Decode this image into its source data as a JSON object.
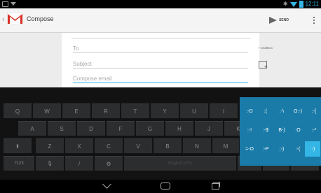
{
  "status_bar": {
    "time": "12:11",
    "bluetooth_glyph": "✱"
  },
  "action_bar": {
    "up_glyph": "‹",
    "title": "Compose",
    "send_label": "SEND"
  },
  "compose": {
    "to_placeholder": "To",
    "subject_placeholder": "Subject",
    "body_placeholder": "Compose email",
    "cc_bcc_label": "+ CC/BCC",
    "attach_plus": "+"
  },
  "keyboard": {
    "row1": [
      "Q",
      "W",
      "E",
      "R",
      "T",
      "Y",
      "U",
      "I"
    ],
    "row2": [
      "A",
      "S",
      "D",
      "F",
      "G",
      "H",
      "J",
      "K"
    ],
    "row3": [
      "Z",
      "X",
      "C",
      "V",
      "B",
      "N",
      "M"
    ],
    "shift_glyph": "⬆",
    "row4": {
      "symbols": "?123",
      "mic": "🎙",
      "slash": "/",
      "settings": "⚙",
      "space": "English (US)",
      "apostrophe": "'",
      "dash": "-",
      "smiley": ":-)"
    },
    "emoji": [
      [
        ":-D",
        ":(",
        ":-\\",
        "O:-)",
        ":-["
      ],
      [
        ":-!",
        ":-$",
        "B-)",
        ":O",
        ":-*"
      ],
      [
        "=-O",
        ":-P",
        ";-)",
        ":-(",
        ":-)"
      ]
    ]
  },
  "nav": {
    "back_icon": "back-icon",
    "home_icon": "home-icon",
    "recents_icon": "recent-apps-icon"
  },
  "colors": {
    "accent": "#33b5e5",
    "gmail_red": "#d93025",
    "keyboard_bg": "#121212"
  }
}
